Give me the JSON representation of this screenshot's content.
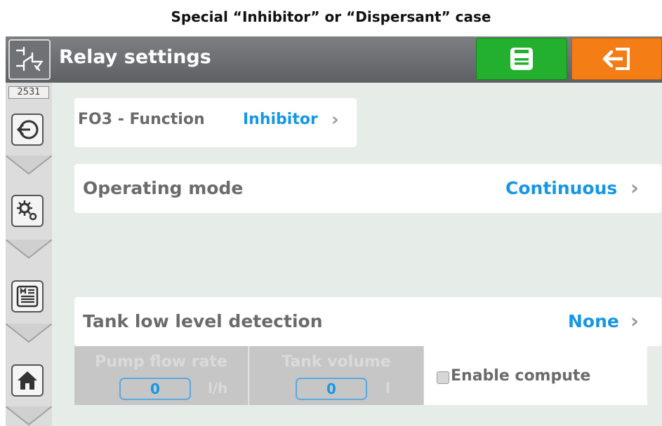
{
  "caption": "Special “Inhibitor” or “Dispersant” case",
  "header": {
    "title": "Relay settings",
    "icon": "relay-icon",
    "save_icon": "floppy-disk-icon",
    "exit_icon": "exit-arrow-icon"
  },
  "sidebar": {
    "badge": "2531",
    "items": [
      {
        "icon": "login-arrow-icon"
      },
      {
        "icon": "settings-gears-icon"
      },
      {
        "icon": "menu-list-icon"
      },
      {
        "icon": "home-icon"
      }
    ]
  },
  "function_row": {
    "label": "FO3 - Function",
    "value": "Inhibitor",
    "arrow": "›"
  },
  "operating_mode": {
    "label": "Operating mode",
    "value": "Continuous",
    "arrow": "›"
  },
  "tank_low": {
    "label": "Tank low level detection",
    "value": "None",
    "arrow": "›"
  },
  "pump_flow": {
    "label": "Pump flow rate",
    "value": "0",
    "unit": "l/h"
  },
  "tank_volume": {
    "label": "Tank volume",
    "value": "0",
    "unit": "l"
  },
  "enable_compute": {
    "label": "Enable compute",
    "checked": false
  },
  "colors": {
    "accent_value": "#1597e5",
    "save_button": "#22b02e",
    "exit_button": "#f47d15",
    "titlebar": "#6a6c70",
    "background": "#e6ece7"
  }
}
